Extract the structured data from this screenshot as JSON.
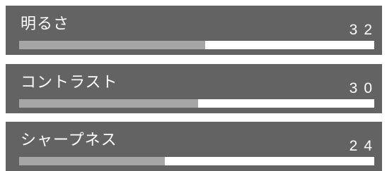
{
  "settings": [
    {
      "label": "明るさ",
      "value": "32",
      "fraction": 0.523
    },
    {
      "label": "コントラスト",
      "value": "30",
      "fraction": 0.503
    },
    {
      "label": "シャープネス",
      "value": "24",
      "fraction": 0.41
    }
  ],
  "colors": {
    "panel_background": "#636363",
    "bar_track": "#ffffff",
    "bar_fill": "#a6a6a6",
    "text": "#ffffff"
  }
}
